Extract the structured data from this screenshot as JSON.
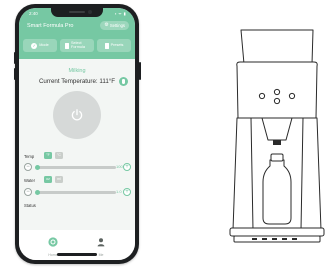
{
  "status_bar": {
    "time": "2:40",
    "icons": "▪ ᯤ ▮"
  },
  "app": {
    "title": "Smart Formula Pro",
    "settings_label": "Settings"
  },
  "modes": [
    {
      "label": "Mode",
      "icon": "check-circle-icon"
    },
    {
      "label": "Select Formula",
      "icon": "document-icon"
    },
    {
      "label": "Presets",
      "icon": "document-icon"
    }
  ],
  "main": {
    "mode_name": "Milking",
    "current_temperature": "Current Temperature: 111°F"
  },
  "controls": {
    "temp": {
      "label": "Temp",
      "unit_primary": "°F",
      "unit_secondary": "°C",
      "value": "100",
      "level": 0.02
    },
    "water": {
      "label": "Water",
      "unit_primary": "oz",
      "unit_secondary": "ml",
      "value": "1.0",
      "level": 0.02
    },
    "status_label": "Status"
  },
  "tabbar": {
    "items": [
      {
        "label": "Home",
        "icon": "home-icon"
      },
      {
        "label": "Me",
        "icon": "person-icon"
      }
    ]
  },
  "colors": {
    "accent": "#76c8a3",
    "phone_body": "#1d1f21",
    "device_outline": "#2a2a2a"
  }
}
